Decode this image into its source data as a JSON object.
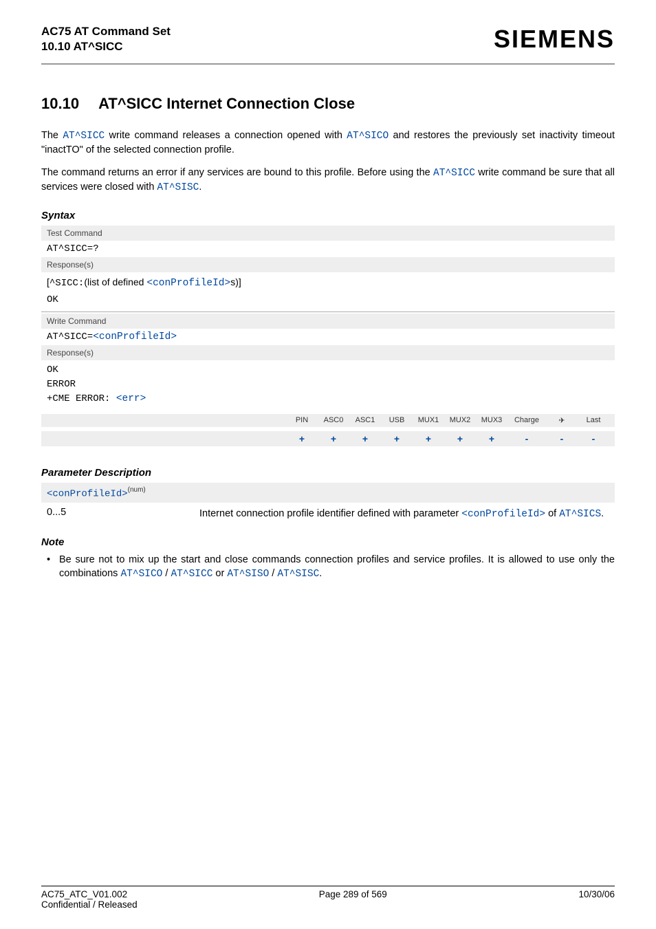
{
  "header": {
    "title1": "AC75 AT Command Set",
    "title2": "10.10 AT^SICC",
    "logo": "SIEMENS"
  },
  "section": {
    "number": "10.10",
    "title": "AT^SICC   Internet Connection Close"
  },
  "para1_a": "The ",
  "para1_link1": "AT^SICC",
  "para1_b": " write command releases a connection opened with ",
  "para1_link2": "AT^SICO",
  "para1_c": " and restores the previously set inactivity timeout \"inactTO\" of the selected connection profile.",
  "para2_a": "The command returns an error if any services are bound to this profile. Before using the ",
  "para2_link1": "AT^SICC",
  "para2_b": " write command be sure that all services were closed with ",
  "para2_link2": "AT^SISC",
  "para2_c": ".",
  "syntax_heading": "Syntax",
  "syntax": {
    "test_label": "Test Command",
    "test_cmd": "AT^SICC=?",
    "resp_label": "Response(s)",
    "resp1_a": "[",
    "resp1_b": "^SICC:",
    "resp1_c": "(list of defined ",
    "resp1_link": "<conProfileId>",
    "resp1_d": "s)]",
    "resp1_ok": "OK",
    "write_label": "Write Command",
    "write_cmd_a": "AT^SICC=",
    "write_cmd_link": "<conProfileId>",
    "resp2_ok": "OK",
    "resp2_err": "ERROR",
    "resp2_cme_a": "+CME ERROR: ",
    "resp2_cme_link": "<err>"
  },
  "support": {
    "cols": [
      "PIN",
      "ASC0",
      "ASC1",
      "USB",
      "MUX1",
      "MUX2",
      "MUX3",
      "Charge",
      "✈",
      "Last"
    ],
    "vals": [
      "+",
      "+",
      "+",
      "+",
      "+",
      "+",
      "+",
      "-",
      "-",
      "-"
    ]
  },
  "param_heading": "Parameter Description",
  "param": {
    "code": "<conProfileId>",
    "sup": "(num)",
    "key": "0...5",
    "val_a": "Internet connection profile identifier defined with parameter ",
    "val_link1": "<conProfileId>",
    "val_b": " of ",
    "val_link2": "AT^SICS",
    "val_c": "."
  },
  "note_heading": "Note",
  "note": {
    "a": "Be sure not to mix up the start and close commands connection profiles and service profiles. It is allowed to use only the combinations ",
    "l1": "AT^SICO",
    "s1": " / ",
    "l2": "AT^SICC",
    "s2": " or ",
    "l3": "AT^SISO",
    "s3": " / ",
    "l4": "AT^SISC",
    "e": "."
  },
  "footer": {
    "left1": "AC75_ATC_V01.002",
    "center": "Page 289 of 569",
    "right": "10/30/06",
    "left2": "Confidential / Released"
  }
}
